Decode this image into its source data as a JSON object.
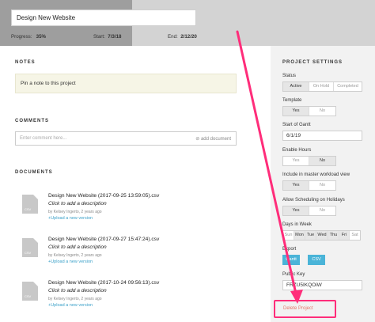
{
  "header": {
    "project_title": "Design New Website",
    "progress_label": "Progress:",
    "progress_value": "35%",
    "start_label": "Start:",
    "start_value": "7/3/18",
    "end_label": "End:",
    "end_value": "2/12/20"
  },
  "notes": {
    "heading": "NOTES",
    "pin_placeholder": "Pin a note to this project"
  },
  "comments": {
    "heading": "COMMENTS",
    "input_placeholder": "Enter comment here...",
    "add_document": "add document"
  },
  "documents": {
    "heading": "DOCUMENTS",
    "icon_label": "CSV",
    "items": [
      {
        "name": "Design New Website (2017-09-25 13:59:05).csv",
        "description": "Click to add a description",
        "by": "by Kelsey Ingerto, 2 years ago",
        "upload": "+Upload a new version"
      },
      {
        "name": "Design New Website (2017-09-27 15:47:24).csv",
        "description": "Click to add a description",
        "by": "by Kelsey Ingerto, 2 years ago",
        "upload": "+Upload a new version"
      },
      {
        "name": "Design New Website (2017-10-24 09:56:13).csv",
        "description": "Click to add a description",
        "by": "by Kelsey Ingerto, 2 years ago",
        "upload": "+Upload a new version"
      }
    ]
  },
  "settings": {
    "heading": "PROJECT SETTINGS",
    "status": {
      "label": "Status",
      "options": [
        "Active",
        "On Hold",
        "Completed"
      ],
      "selected": "Active"
    },
    "template": {
      "label": "Template",
      "options": [
        "Yes",
        "No"
      ],
      "selected": "Yes"
    },
    "start_of_gantt": {
      "label": "Start of Gantt",
      "value": "6/1/19"
    },
    "enable_hours": {
      "label": "Enable Hours",
      "options": [
        "Yes",
        "No"
      ],
      "selected": "No"
    },
    "master_workload": {
      "label": "Include in master workload view",
      "options": [
        "Yes",
        "No"
      ],
      "selected": "Yes"
    },
    "allow_holidays": {
      "label": "Allow Scheduling on Holidays",
      "options": [
        "Yes",
        "No"
      ],
      "selected": "Yes"
    },
    "days_in_week": {
      "label": "Days in Week",
      "options": [
        "Sun",
        "Mon",
        "Tue",
        "Wed",
        "Thu",
        "Fri",
        "Sat"
      ],
      "selected": [
        "Mon",
        "Tue",
        "Wed",
        "Thu",
        "Fri"
      ]
    },
    "export": {
      "label": "Export",
      "options": [
        "Gantt",
        "CSV"
      ]
    },
    "public_key": {
      "label": "Public Key",
      "value": "FRZU5IKQOiW"
    },
    "delete_label": "Delete Project"
  },
  "colors": {
    "accent": "#4ab4d8",
    "annotation": "#ff2d7a",
    "delete": "#e8756a",
    "note_bg": "#f6f5e6"
  }
}
